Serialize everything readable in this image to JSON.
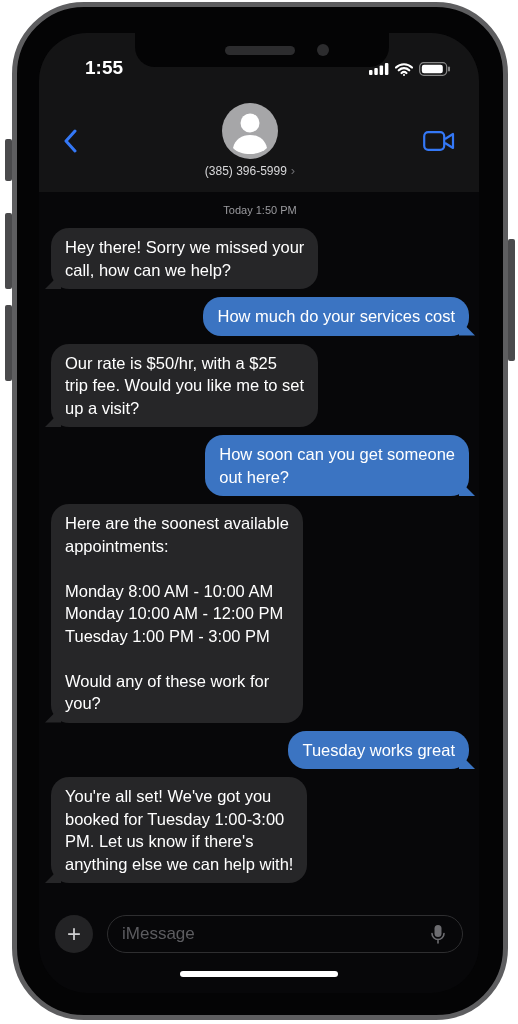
{
  "status_bar": {
    "time": "1:55"
  },
  "header": {
    "contact": "(385) 396-5999",
    "chevron": "›"
  },
  "timestamp": "Today 1:50 PM",
  "messages": [
    {
      "kind": "incoming",
      "text": "Hey there! Sorry we missed your\ncall, how can we help?"
    },
    {
      "kind": "outgoing",
      "text": "How much do your services cost"
    },
    {
      "kind": "incoming",
      "text": "Our rate is $50/hr, with a $25\ntrip fee. Would you like me to set\nup a visit?"
    },
    {
      "kind": "outgoing",
      "text": "How soon can you get someone\nout here?"
    },
    {
      "kind": "incoming",
      "text": "Here are the soonest available\nappointments:\n\nMonday 8:00 AM - 10:00 AM\nMonday 10:00 AM - 12:00 PM\nTuesday 1:00 PM - 3:00 PM\n\nWould any of these work for\nyou?"
    },
    {
      "kind": "outgoing",
      "text": "Tuesday works great"
    },
    {
      "kind": "incoming",
      "text": "You're all set! We've got you\nbooked for Tuesday 1:00-3:00\nPM. Let us know if there's\nanything else we can help with!"
    }
  ],
  "composer": {
    "plus": "+",
    "placeholder": "iMessage"
  }
}
